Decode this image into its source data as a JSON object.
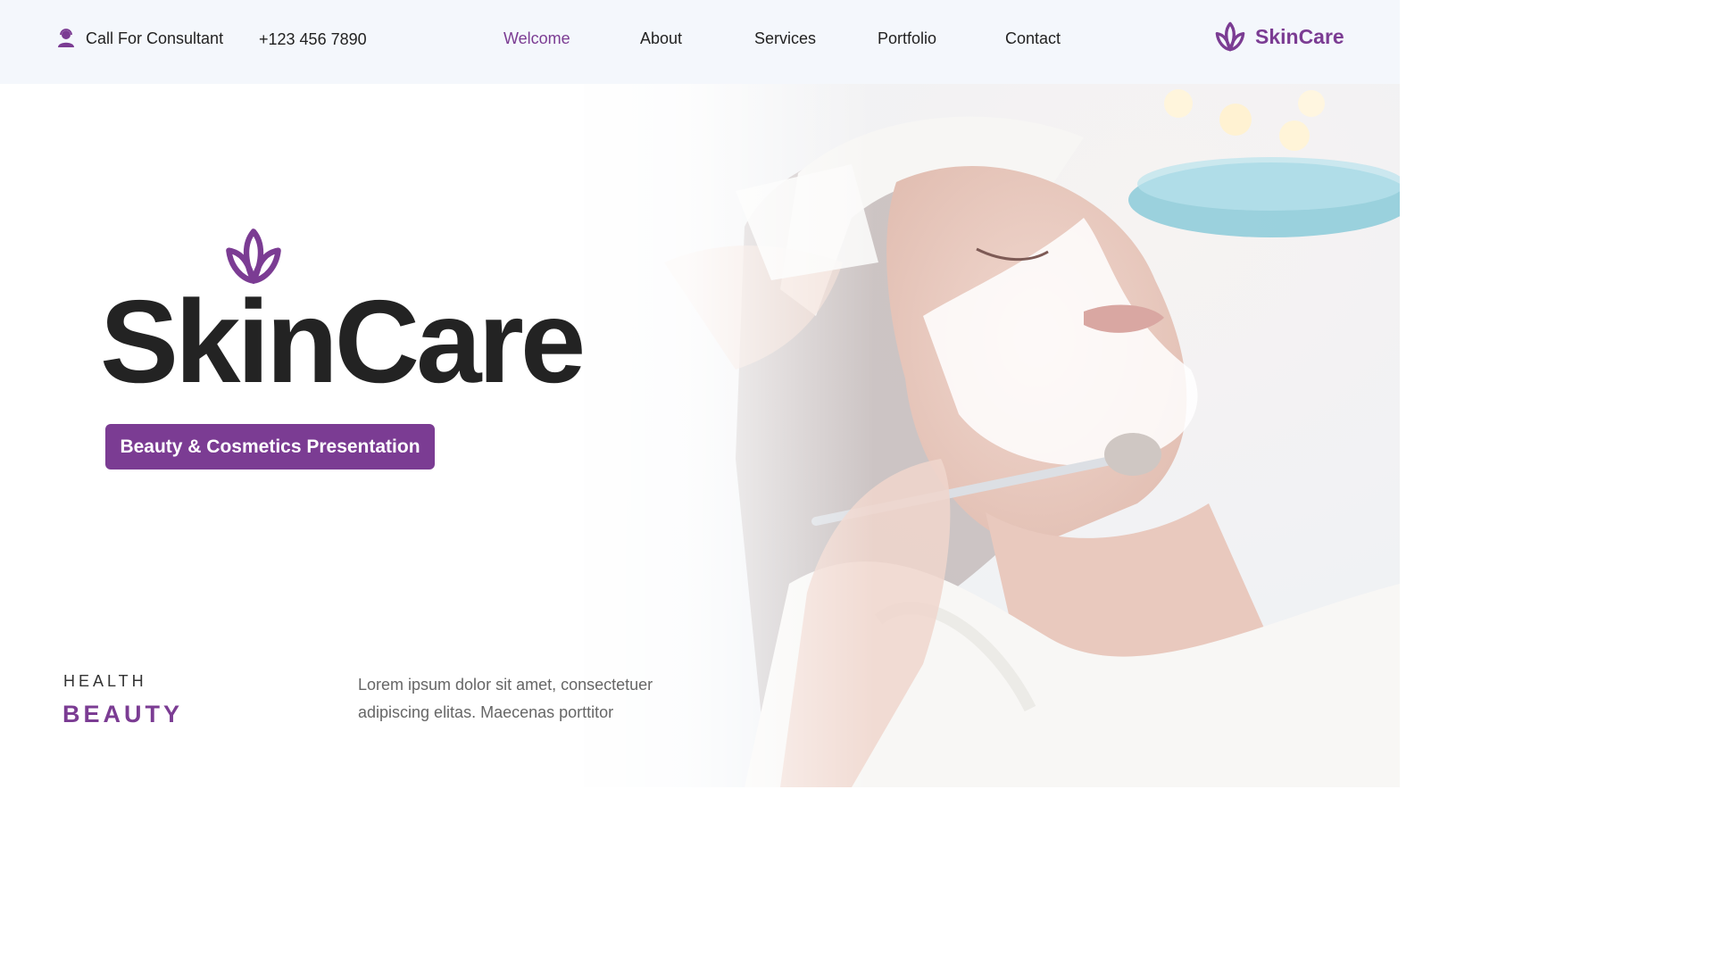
{
  "header": {
    "consult_label": "Call For Consultant",
    "phone": "+123 456 7890",
    "nav": [
      "Welcome",
      "About",
      "Services",
      "Portfolio",
      "Contact"
    ],
    "active_nav": "Welcome",
    "brand": "SkinCare"
  },
  "hero": {
    "title": "SkinCare",
    "pill_label": "Beauty & Cosmetics Presentation"
  },
  "footer_block": {
    "eyebrow": "HEALTH",
    "heading": "BEAUTY",
    "text": "Lorem ipsum dolor sit amet, consectetuer adipiscing elitas. Maecenas porttitor"
  },
  "colors": {
    "accent": "#7b3c93",
    "topbar_bg": "#f4f7fc",
    "text": "#232323"
  },
  "icons": {
    "consult": "user-headset-icon",
    "logo": "lotus-icon"
  }
}
